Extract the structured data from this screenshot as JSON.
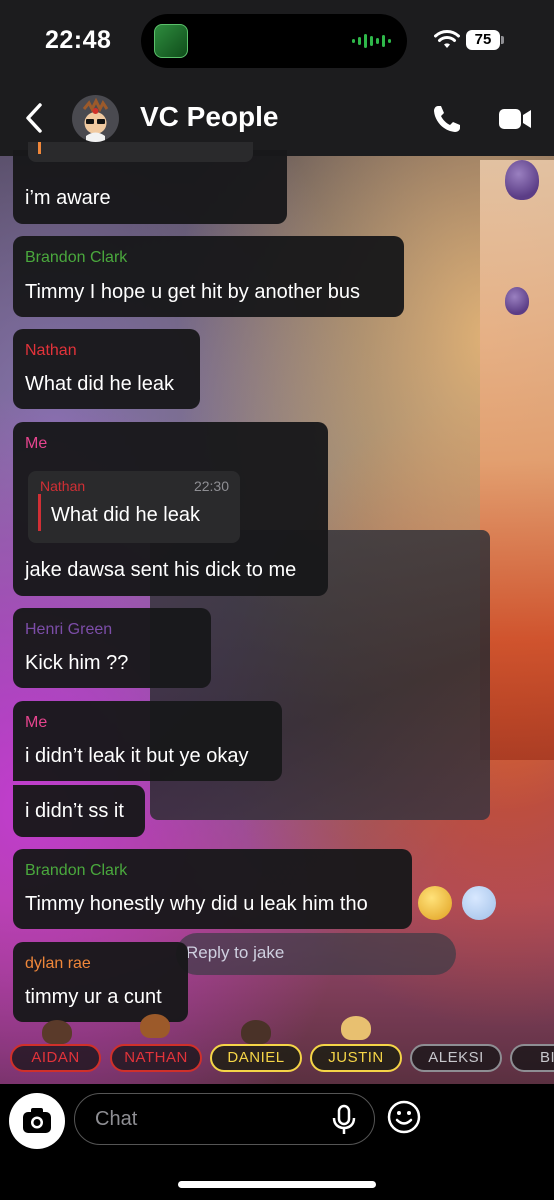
{
  "status_bar": {
    "time": "22:48",
    "battery": "75"
  },
  "header": {
    "title": "VC People"
  },
  "partial_message": {
    "text": "i’m aware"
  },
  "messages": [
    {
      "sender": "Brandon Clark",
      "text": "Timmy I hope u get hit by another bus"
    },
    {
      "sender": "Nathan",
      "text": "What did he leak"
    },
    {
      "sender": "Me",
      "quote_sender": "Nathan",
      "quote_time": "22:30",
      "quote_text": "What did he leak",
      "text": "jake dawsa sent his dick to me"
    },
    {
      "sender": "Henri Green",
      "text": "Kick him ??"
    },
    {
      "sender": "Me",
      "text": "i didn’t leak it but ye okay"
    },
    {
      "text": "i didn’t ss it"
    },
    {
      "sender": "Brandon Clark",
      "text": "Timmy honestly why did u leak him tho"
    },
    {
      "sender": "dylan rae",
      "text": "timmy ur a cunt"
    }
  ],
  "background_ui": {
    "reply_placeholder": "Reply to jake"
  },
  "presence": [
    "AIDAN",
    "NATHAN",
    "DANIEL",
    "JUSTIN",
    "ALEKSI",
    "BI"
  ],
  "input": {
    "placeholder": "Chat"
  },
  "colors": {
    "brandon": "#4aa83d",
    "nathan": "#e2333a",
    "me": "#e6448e",
    "henri": "#7c4da8",
    "dylan": "#f0873a",
    "presence_yellow": "#f5d547"
  },
  "icons": [
    "back-chevron-icon",
    "phone-icon",
    "video-camera-icon",
    "camera-icon",
    "microphone-icon",
    "emoji-icon",
    "wifi-icon",
    "battery-icon"
  ]
}
